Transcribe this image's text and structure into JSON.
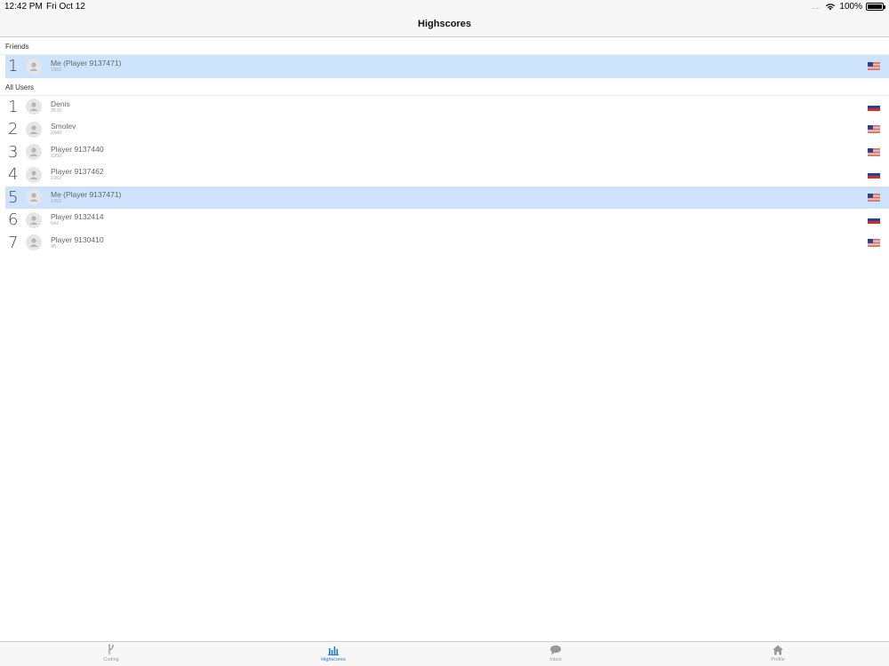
{
  "status": {
    "time": "12:42 PM",
    "date": "Fri Oct 12",
    "battery": "100%",
    "battery_level": 1.0,
    "signal_dots": "....",
    "wifi_icon": "wifi-icon",
    "battery_icon": "battery-icon"
  },
  "nav": {
    "title": "Highscores"
  },
  "sections": {
    "friends": {
      "label": "Friends",
      "rows": [
        {
          "rank": "1",
          "name": "Me (Player 9137471)",
          "score": "1952",
          "flag": "us",
          "highlight": true
        }
      ]
    },
    "all_users": {
      "label": "All Users",
      "rows": [
        {
          "rank": "1",
          "name": "Denis",
          "score": "3570",
          "flag": "ru",
          "highlight": false
        },
        {
          "rank": "2",
          "name": "Smolev",
          "score": "2440",
          "flag": "us",
          "highlight": false
        },
        {
          "rank": "3",
          "name": "Player 9137440",
          "score": "1950",
          "flag": "us",
          "highlight": false
        },
        {
          "rank": "4",
          "name": "Player 9137462",
          "score": "1952",
          "flag": "ru",
          "highlight": false
        },
        {
          "rank": "5",
          "name": "Me (Player 9137471)",
          "score": "1952",
          "flag": "us",
          "highlight": true
        },
        {
          "rank": "6",
          "name": "Player 9132414",
          "score": "642",
          "flag": "ru",
          "highlight": false
        },
        {
          "rank": "7",
          "name": "Player 9130410",
          "score": "45",
          "flag": "us",
          "highlight": false
        }
      ]
    }
  },
  "tabs": [
    {
      "label": "Coding",
      "icon": "branch-icon",
      "active": false
    },
    {
      "label": "Highscores",
      "icon": "bar-chart-icon",
      "active": true
    },
    {
      "label": "Inbox",
      "icon": "chat-bubble-icon",
      "active": false
    },
    {
      "label": "Profile",
      "icon": "home-icon",
      "active": false
    }
  ],
  "colors": {
    "accent": "#1a7ad9",
    "highlight_row": "#cce3fb"
  }
}
